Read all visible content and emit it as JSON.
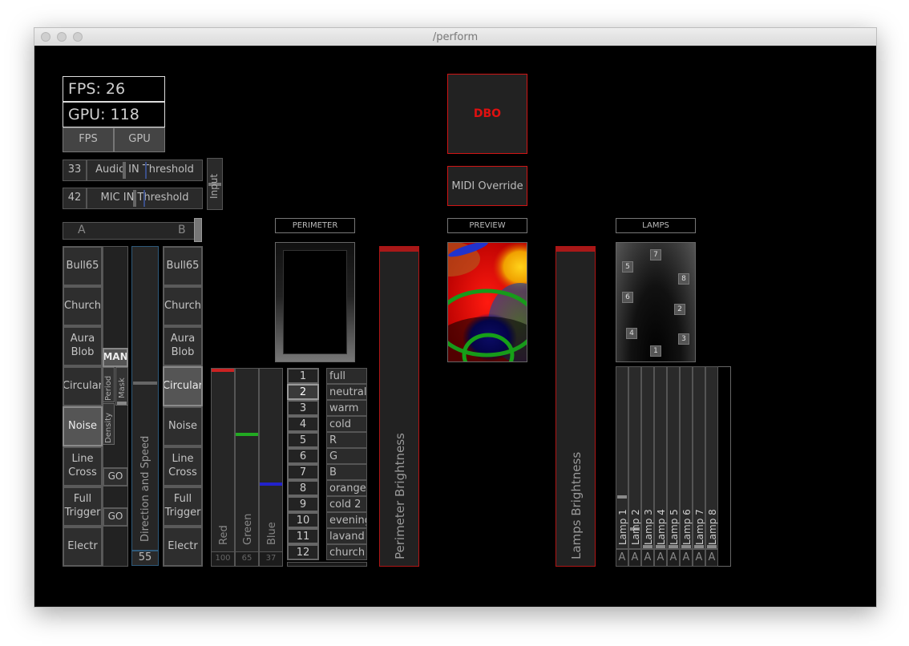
{
  "window": {
    "title": "/perform"
  },
  "stats": {
    "fps": "FPS: 26",
    "gpu": "GPU: 118",
    "fps_button": "FPS",
    "gpu_button": "GPU"
  },
  "audio": {
    "audio_value": "33",
    "audio_label": "Audio IN Threshold",
    "mic_value": "42",
    "mic_label": "MIC IN Threshold",
    "input_label": "Input"
  },
  "crossfader": {
    "a": "A",
    "b": "B"
  },
  "deck_a": [
    {
      "label": "Bull65",
      "active": false
    },
    {
      "label": "Church",
      "active": false
    },
    {
      "label": "Aura\nBlob",
      "active": false
    },
    {
      "label": "Circular",
      "active": false
    },
    {
      "label": "Noise",
      "active": true
    },
    {
      "label": "Line\nCross",
      "active": false
    },
    {
      "label": "Full\nTrigger",
      "active": false
    },
    {
      "label": "Electr",
      "active": false
    }
  ],
  "deck_b": [
    {
      "label": "Bull65",
      "active": false
    },
    {
      "label": "Church",
      "active": false
    },
    {
      "label": "Aura\nBlob",
      "active": false
    },
    {
      "label": "Circular",
      "active": true
    },
    {
      "label": "Noise",
      "active": false
    },
    {
      "label": "Line\nCross",
      "active": false
    },
    {
      "label": "Full\nTrigger",
      "active": false
    },
    {
      "label": "Electr",
      "active": false
    }
  ],
  "middle": {
    "man": "MAN",
    "period": "Period",
    "density": "Density",
    "mask": "Mask",
    "go1": "GO",
    "go2": "GO",
    "direction_label": "Direction and Speed",
    "direction_value": "55"
  },
  "rgb": {
    "red_label": "Red",
    "green_label": "Green",
    "blue_label": "Blue",
    "red_value": "100",
    "green_value": "65",
    "blue_value": "37",
    "red_color": "#cc2222",
    "green_color": "#22aa22",
    "blue_color": "#2222cc"
  },
  "presets": {
    "numbers": [
      "1",
      "2",
      "3",
      "4",
      "5",
      "6",
      "7",
      "8",
      "9",
      "10",
      "11",
      "12"
    ],
    "selected": "2",
    "names": [
      "full",
      "neutral",
      "warm",
      "cold",
      "R",
      "G",
      "B",
      "orange",
      "cold 2",
      "evening",
      "lavand",
      "church"
    ]
  },
  "perimeter": {
    "label": "PERIMETER",
    "brightness_label": "Perimeter Brightness"
  },
  "dbo": {
    "label": "DBO",
    "midi_label": "MIDI Override",
    "accent": "#e01010"
  },
  "preview": {
    "label": "PREVIEW"
  },
  "lamps_panel": {
    "label": "LAMPS",
    "brightness_label": "Lamps Brightness",
    "markers": [
      "7",
      "5",
      "8",
      "6",
      "2",
      "4",
      "3",
      "1"
    ],
    "faders": [
      "Lamp 1",
      "Lamp 2",
      "Lamp 3",
      "Lamp 4",
      "Lamp 5",
      "Lamp 6",
      "Lamp 7",
      "Lamp 8"
    ],
    "buttons": [
      "A",
      "A",
      "A",
      "A",
      "A",
      "A",
      "A",
      "A"
    ]
  }
}
